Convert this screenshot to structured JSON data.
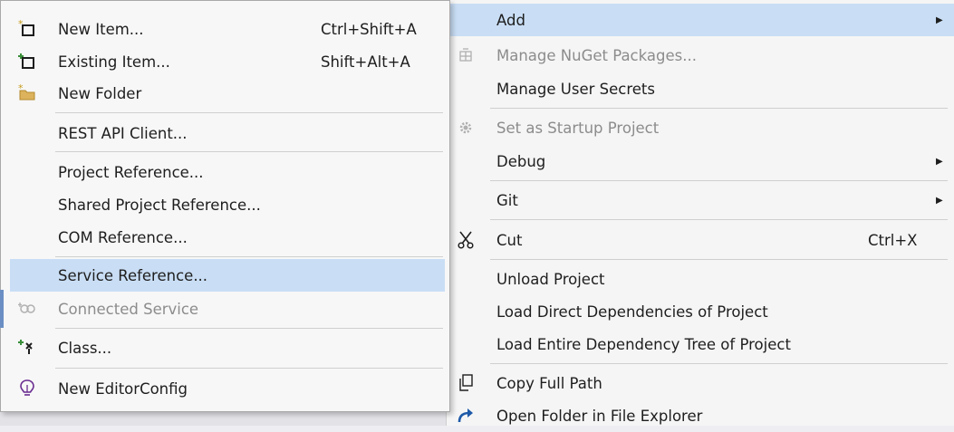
{
  "main_menu": {
    "add": "Add",
    "manage_nuget": "Manage NuGet Packages...",
    "manage_secrets": "Manage User Secrets",
    "set_startup": "Set as Startup Project",
    "debug": "Debug",
    "git": "Git",
    "cut": "Cut",
    "cut_shortcut": "Ctrl+X",
    "unload": "Unload Project",
    "load_direct": "Load Direct Dependencies of Project",
    "load_tree": "Load Entire Dependency Tree of Project",
    "copy_path": "Copy Full Path",
    "open_folder": "Open Folder in File Explorer"
  },
  "add_submenu": {
    "new_item": "New Item...",
    "new_item_shortcut": "Ctrl+Shift+A",
    "existing_item": "Existing Item...",
    "existing_item_shortcut": "Shift+Alt+A",
    "new_folder": "New Folder",
    "rest_api": "REST API Client...",
    "project_ref": "Project Reference...",
    "shared_project_ref": "Shared Project Reference...",
    "com_ref": "COM Reference...",
    "service_ref": "Service Reference...",
    "connected_service": "Connected Service",
    "class": "Class...",
    "editorconfig": "New EditorConfig"
  },
  "colors": {
    "highlight": "#c9def5",
    "menu_bg": "#f5f5f5",
    "disabled_text": "#8c8c8c",
    "accent_blue": "#1e5aa8"
  }
}
